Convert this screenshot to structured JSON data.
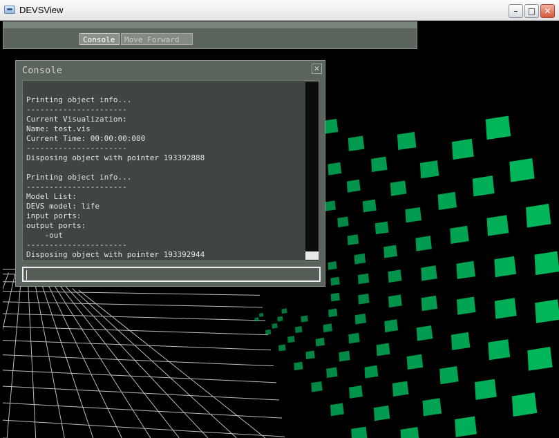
{
  "window": {
    "title": "DEVSView",
    "min_label": "–",
    "max_label": "□",
    "close_label": "✕"
  },
  "toolbar": {
    "console_label": "Console",
    "move_forward_label": "Move Forward"
  },
  "console": {
    "title": "Console",
    "close_label": "✕",
    "lines": [
      "Printing object info...",
      "----------------------",
      "Current Visualization:",
      "Name: test.vis",
      "Current Time: 00:00:00:000",
      "----------------------",
      "Disposing object with pointer 193392888",
      "",
      "Printing object info...",
      "----------------------",
      "Model List:",
      "DEVS model: life",
      "input ports:",
      "output ports:",
      "    -out",
      "----------------------",
      "Disposing object with pointer 193392944"
    ],
    "input_value": "",
    "scroll_fraction": 1.0
  },
  "colors": {
    "cube_green": "#00cc66",
    "grid_line": "#bdbdbd",
    "panel_bg": "#5a635c"
  },
  "icons": {
    "app": "devsview-app-icon",
    "close": "close-icon"
  }
}
